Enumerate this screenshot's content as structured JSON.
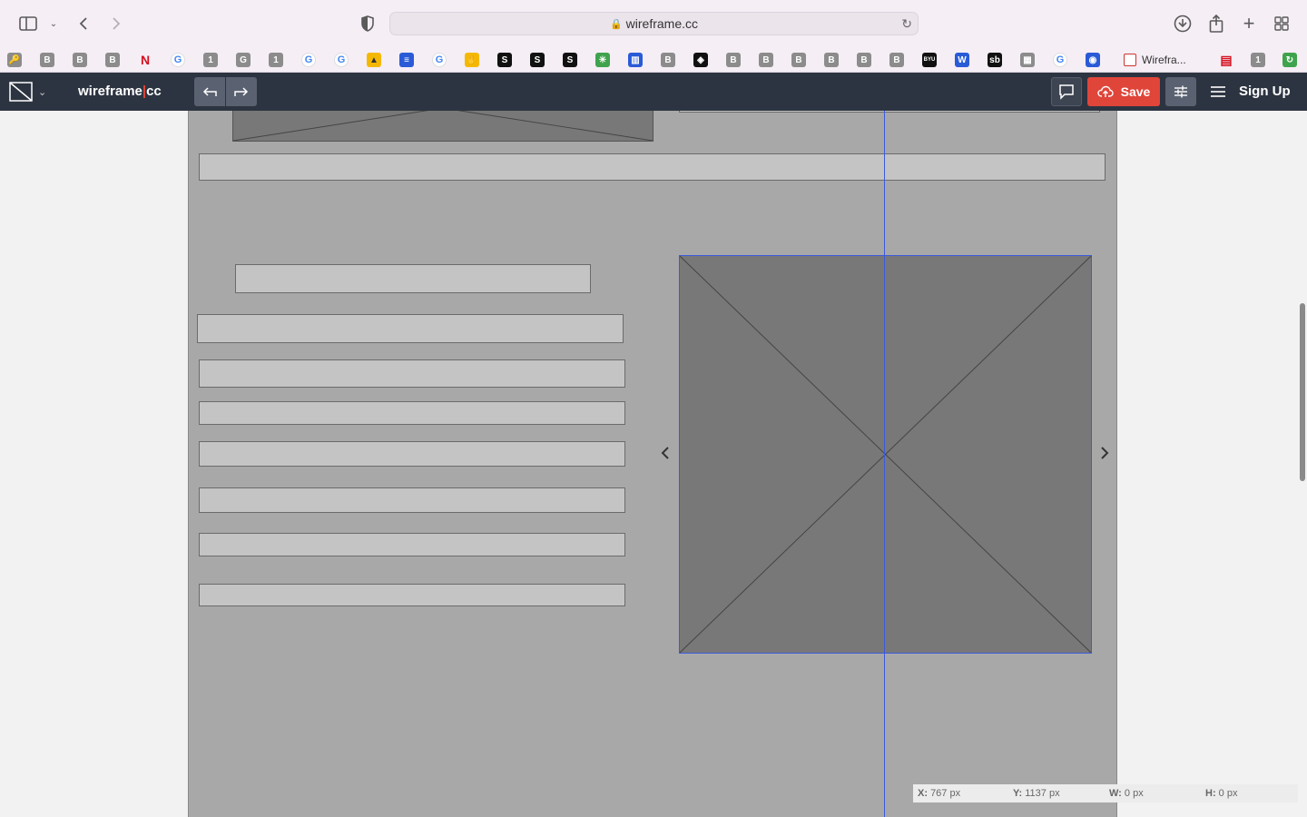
{
  "browser": {
    "url": "wireframe.cc",
    "tab_label": "Wirefra...",
    "bookmarks": [
      {
        "icon": "bookmark-key-icon",
        "glyph": "🔑"
      },
      {
        "icon": "bookmark-b-icon",
        "glyph": "B"
      },
      {
        "icon": "bookmark-b-icon",
        "glyph": "B"
      },
      {
        "icon": "bookmark-b-icon",
        "glyph": "B"
      },
      {
        "icon": "netflix-icon",
        "glyph": "N"
      },
      {
        "icon": "google-icon",
        "glyph": "G"
      },
      {
        "icon": "bookmark-1-icon",
        "glyph": "1"
      },
      {
        "icon": "bookmark-g-icon",
        "glyph": "G"
      },
      {
        "icon": "bookmark-1-icon",
        "glyph": "1"
      },
      {
        "icon": "google-icon",
        "glyph": "G"
      },
      {
        "icon": "google-icon",
        "glyph": "G"
      },
      {
        "icon": "google-drive-icon",
        "glyph": "▲"
      },
      {
        "icon": "google-docs-icon",
        "glyph": "≡"
      },
      {
        "icon": "google-icon",
        "glyph": "G"
      },
      {
        "icon": "hand-icon",
        "glyph": "✋"
      },
      {
        "icon": "bookmark-s-icon",
        "glyph": "S"
      },
      {
        "icon": "bookmark-s-icon",
        "glyph": "S"
      },
      {
        "icon": "bookmark-s-icon",
        "glyph": "S"
      },
      {
        "icon": "sparkle-icon",
        "glyph": "✳"
      },
      {
        "icon": "chart-icon",
        "glyph": "▥"
      },
      {
        "icon": "bookmark-b-icon",
        "glyph": "B"
      },
      {
        "icon": "codepen-icon",
        "glyph": "◈"
      },
      {
        "icon": "bookmark-b-icon",
        "glyph": "B"
      },
      {
        "icon": "bookmark-b-icon",
        "glyph": "B"
      },
      {
        "icon": "bookmark-b-icon",
        "glyph": "B"
      },
      {
        "icon": "bookmark-b-icon",
        "glyph": "B"
      },
      {
        "icon": "bookmark-b-icon",
        "glyph": "B"
      },
      {
        "icon": "bookmark-b-icon",
        "glyph": "B"
      },
      {
        "icon": "byu-icon",
        "glyph": "BYU"
      },
      {
        "icon": "word-icon",
        "glyph": "W"
      },
      {
        "icon": "sb-icon",
        "glyph": "sb"
      },
      {
        "icon": "image-icon",
        "glyph": "▦"
      },
      {
        "icon": "google-icon",
        "glyph": "G"
      },
      {
        "icon": "steam-icon",
        "glyph": "◉"
      }
    ],
    "right_bookmarks": [
      {
        "icon": "reading-list-icon",
        "glyph": "▤"
      },
      {
        "icon": "bookmark-1-icon",
        "glyph": "1"
      },
      {
        "icon": "refresh-green-icon",
        "glyph": "↻"
      }
    ]
  },
  "app": {
    "logo_left": "wireframe",
    "logo_sep": "|",
    "logo_right": "cc",
    "save_label": "Save",
    "signup_label": "Sign Up"
  },
  "status": {
    "x_label": "X:",
    "x_value": "767 px",
    "y_label": "Y:",
    "y_value": "1137 px",
    "w_label": "W:",
    "w_value": "0 px",
    "h_label": "H:",
    "h_value": "0 px"
  }
}
